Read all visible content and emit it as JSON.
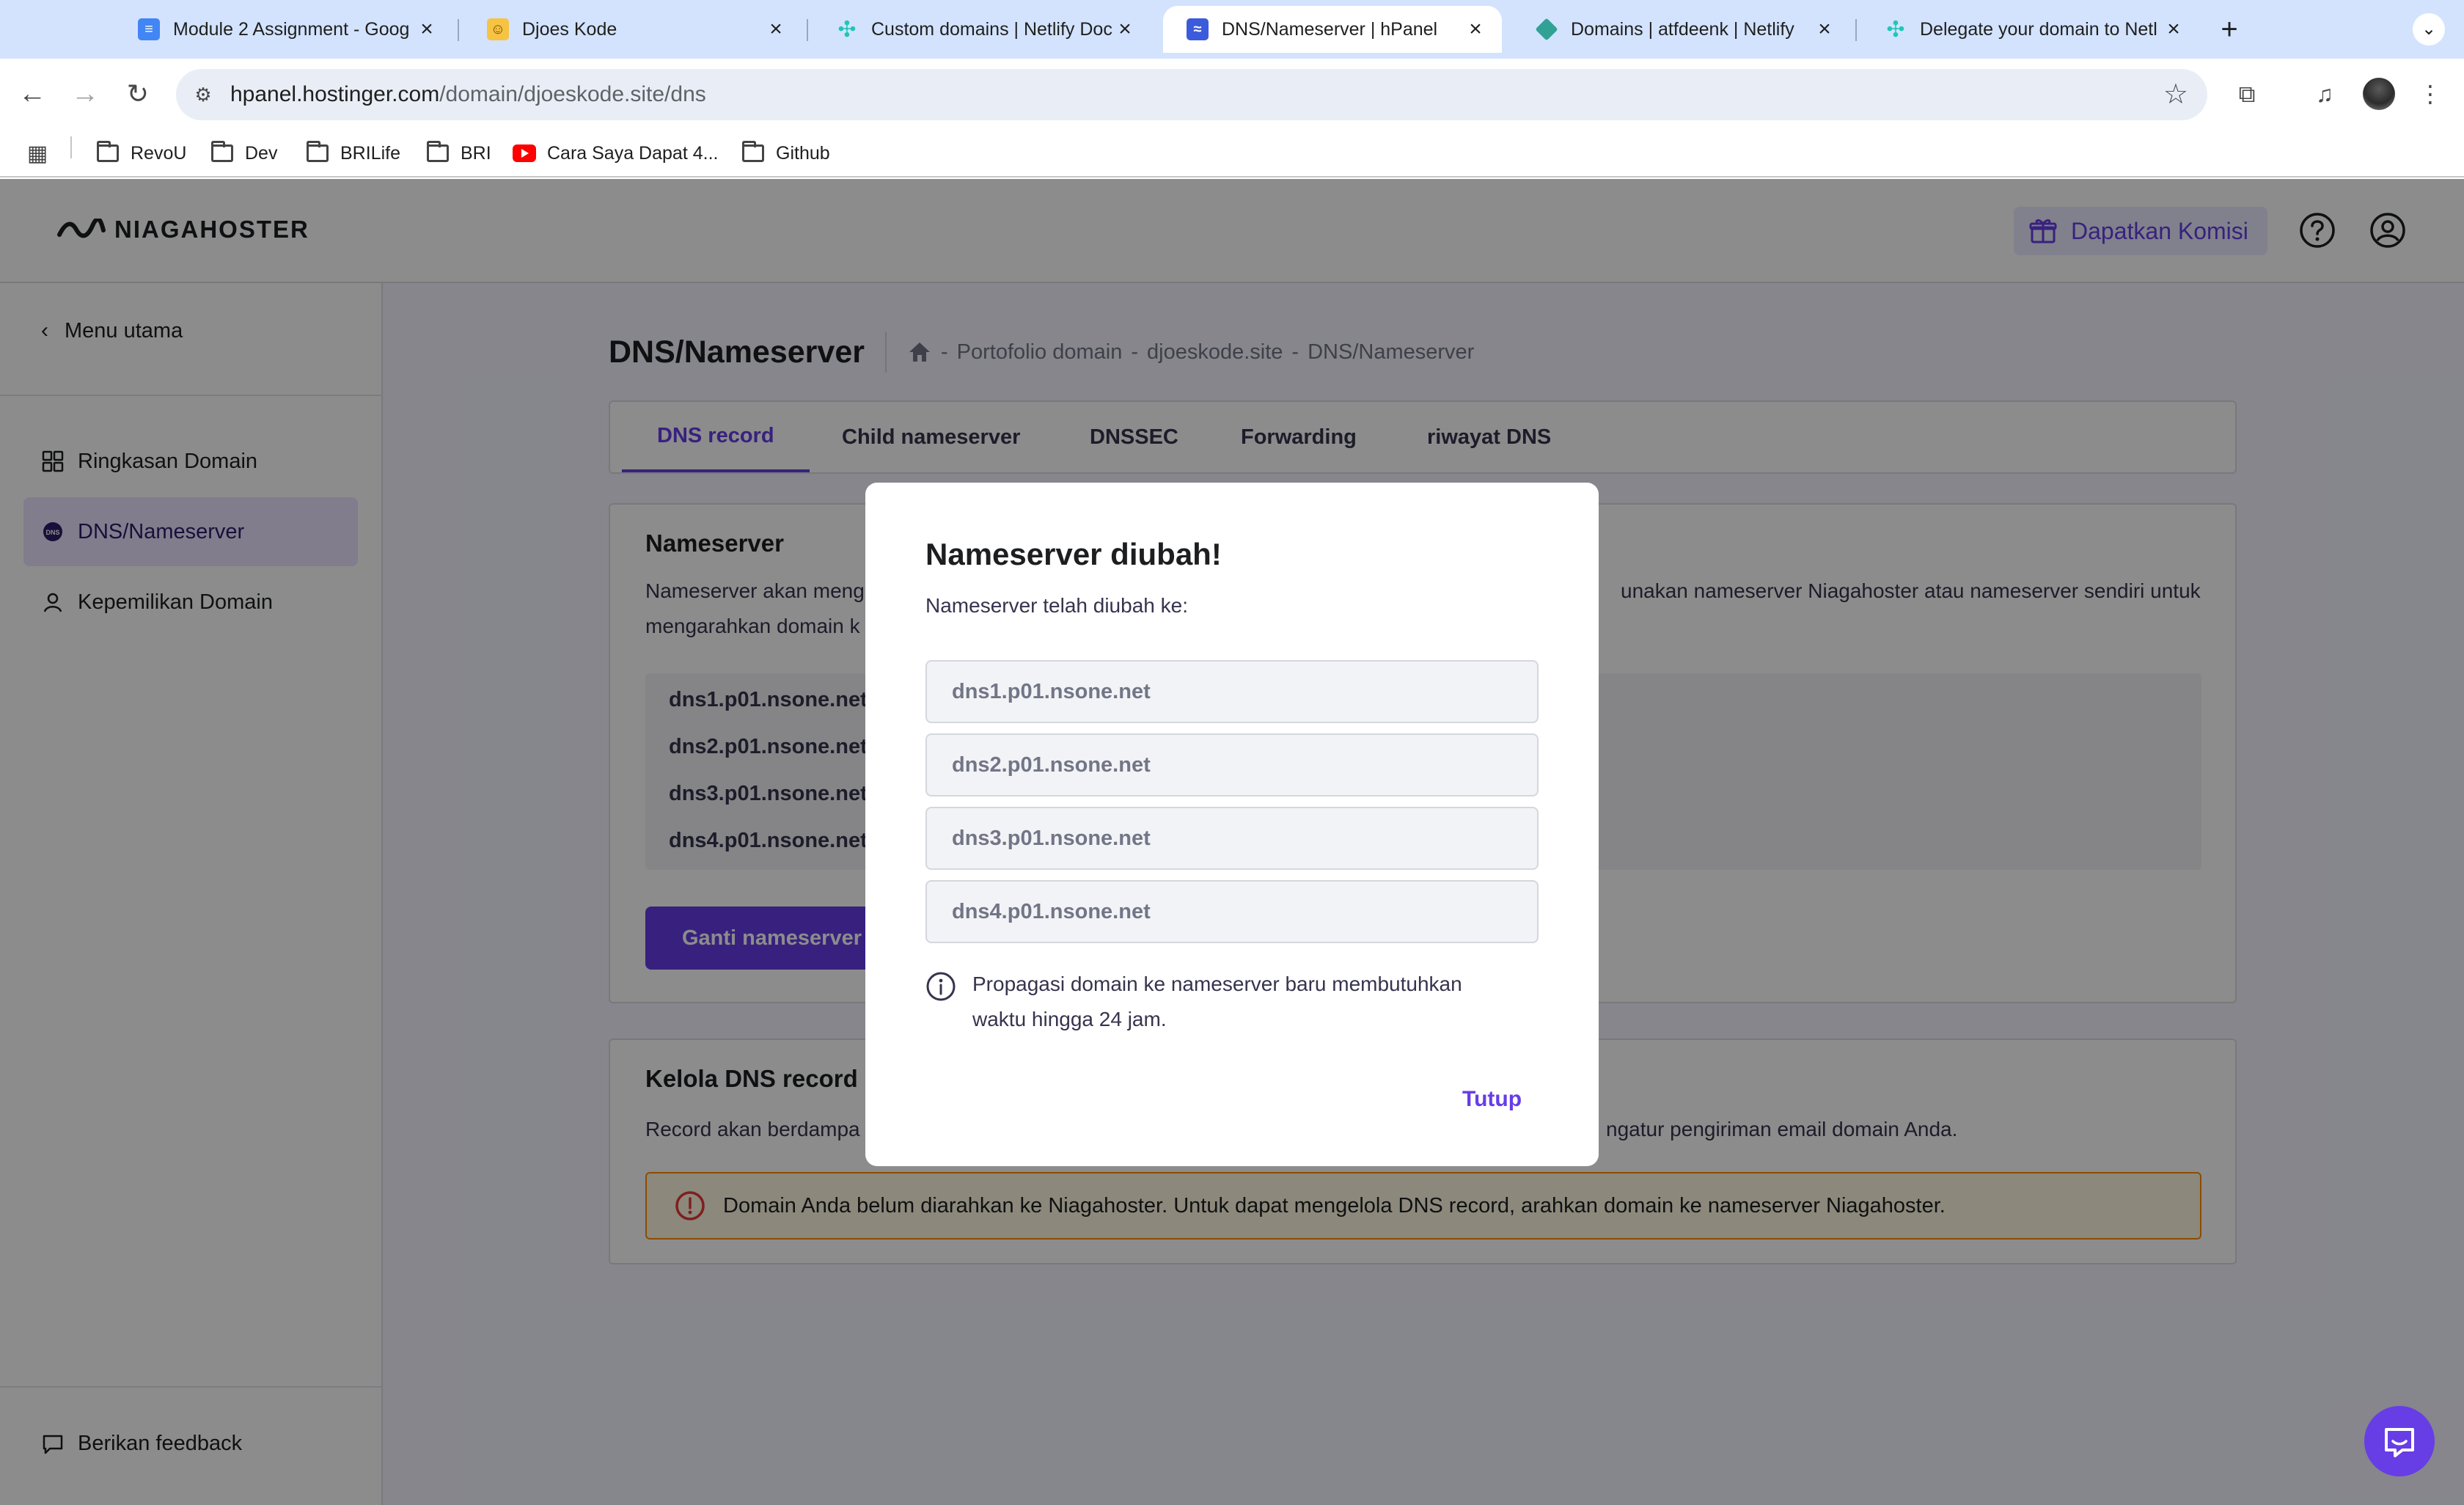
{
  "browser": {
    "tabs": [
      {
        "title": "Module 2 Assignment - Goog",
        "favicon": "google-docs-icon",
        "favicon_color": "#4285f4"
      },
      {
        "title": "Djoes Kode",
        "favicon": "djoes-kode-icon",
        "favicon_color": "#f6c343"
      },
      {
        "title": "Custom domains | Netlify Doc",
        "favicon": "netlify-docs-icon",
        "favicon_color": "#20c6b7"
      },
      {
        "title": "DNS/Nameserver | hPanel",
        "favicon": "hpanel-icon",
        "favicon_color": "#3b5bdb"
      },
      {
        "title": "Domains | atfdeenk | Netlify",
        "favicon": "netlify-icon",
        "favicon_color": "#32a195"
      },
      {
        "title": "Delegate your domain to Netl",
        "favicon": "netlify-docs-icon",
        "favicon_color": "#20c6b7"
      }
    ],
    "active_tab_index": 3,
    "url_host": "hpanel.hostinger.com",
    "url_path": "/domain/djoeskode.site/dns",
    "bookmarks": [
      {
        "label": "RevoU",
        "icon": "folder-icon"
      },
      {
        "label": "Dev",
        "icon": "folder-icon"
      },
      {
        "label": "BRILife",
        "icon": "folder-icon"
      },
      {
        "label": "BRI",
        "icon": "folder-icon"
      },
      {
        "label": "Cara Saya Dapat 4...",
        "icon": "youtube-icon"
      },
      {
        "label": "Github",
        "icon": "folder-icon"
      }
    ]
  },
  "app": {
    "brand": "NIAGAHOSTER",
    "komisi_label": "Dapatkan Komisi",
    "accent_color": "#673de6",
    "sidebar": {
      "back_label": "Menu utama",
      "items": [
        {
          "label": "Ringkasan Domain",
          "icon": "grid-icon",
          "active": false
        },
        {
          "label": "DNS/Nameserver",
          "icon": "dns-icon",
          "active": true
        },
        {
          "label": "Kepemilikan Domain",
          "icon": "user-icon",
          "active": false
        }
      ],
      "feedback_label": "Berikan feedback"
    },
    "page": {
      "title": "DNS/Nameserver",
      "breadcrumb": [
        "Portofolio domain",
        "djoeskode.site",
        "DNS/Nameserver"
      ],
      "breadcrumb_sep": "-",
      "tabs": [
        "DNS record",
        "Child nameserver",
        "DNSSEC",
        "Forwarding",
        "riwayat DNS"
      ],
      "active_tab": 0
    },
    "nameserver_card": {
      "title": "Nameserver",
      "desc_left": "Nameserver akan meng",
      "desc_right": "unakan nameserver Niagahoster atau nameserver sendiri untuk",
      "desc_line2": "mengarahkan domain k",
      "nameservers": [
        "dns1.p01.nsone.net",
        "dns2.p01.nsone.net",
        "dns3.p01.nsone.net",
        "dns4.p01.nsone.net"
      ],
      "button_label": "Ganti nameserver"
    },
    "dns_card": {
      "title": "Kelola DNS record",
      "desc_left": "Record akan berdampa",
      "desc_right": "ngatur pengiriman email domain Anda.",
      "alert": "Domain Anda belum diarahkan ke Niagahoster. Untuk dapat mengelola DNS record, arahkan domain ke nameserver Niagahoster."
    }
  },
  "modal": {
    "title": "Nameserver diubah!",
    "subtitle": "Nameserver telah diubah ke:",
    "nameservers": [
      "dns1.p01.nsone.net",
      "dns2.p01.nsone.net",
      "dns3.p01.nsone.net",
      "dns4.p01.nsone.net"
    ],
    "info": "Propagasi domain ke nameserver baru membutuhkan waktu hingga 24 jam.",
    "close_label": "Tutup"
  }
}
